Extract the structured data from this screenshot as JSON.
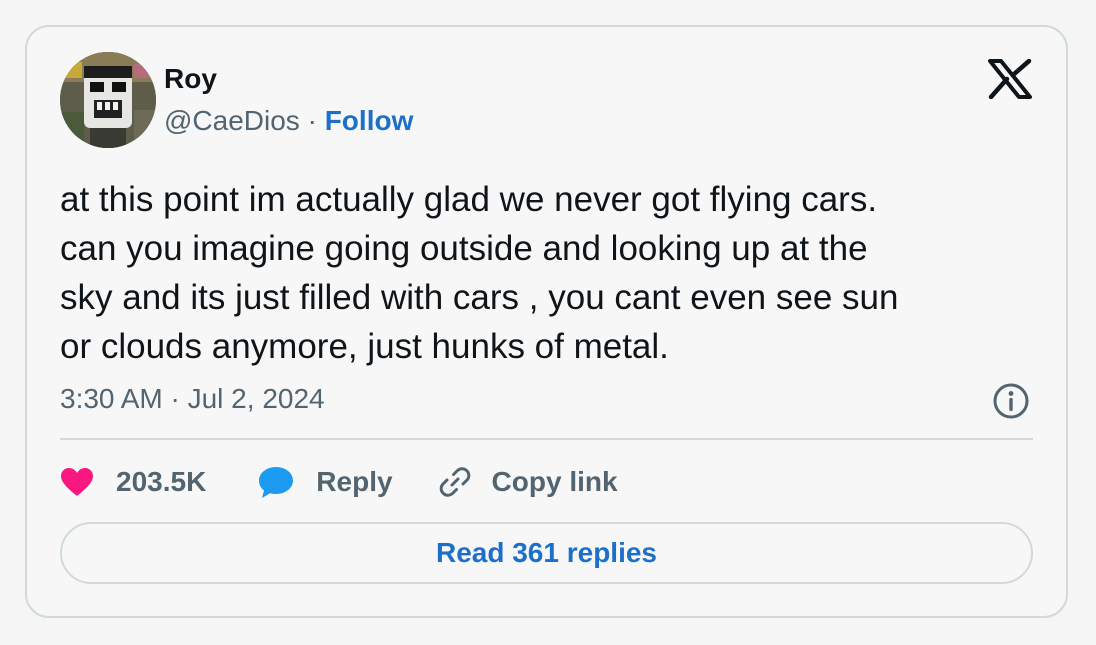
{
  "author": {
    "name": "Roy",
    "handle": "@CaeDios",
    "separator": " · ",
    "follow_label": "Follow"
  },
  "tweet": {
    "lines": [
      "at this point im actually glad we never got flying cars.",
      "can you imagine going outside and looking up at the",
      "sky and its just filled with cars , you cant even see sun",
      "or clouds anymore, just hunks of metal."
    ],
    "timestamp": "3:30 AM · Jul 2, 2024"
  },
  "actions": {
    "like_count": "203.5K",
    "reply_label": "Reply",
    "copy_link_label": "Copy link"
  },
  "read_replies_label": "Read 361 replies",
  "icons": {
    "logo": "x-logo-icon",
    "info": "info-icon",
    "like": "heart-icon",
    "reply": "speech-bubble-icon",
    "copy_link": "link-icon"
  },
  "colors": {
    "accent": "#1d70c9",
    "like": "#f91880",
    "reply": "#1d9bf0",
    "muted_text": "#536471",
    "border": "#cfd9de"
  }
}
